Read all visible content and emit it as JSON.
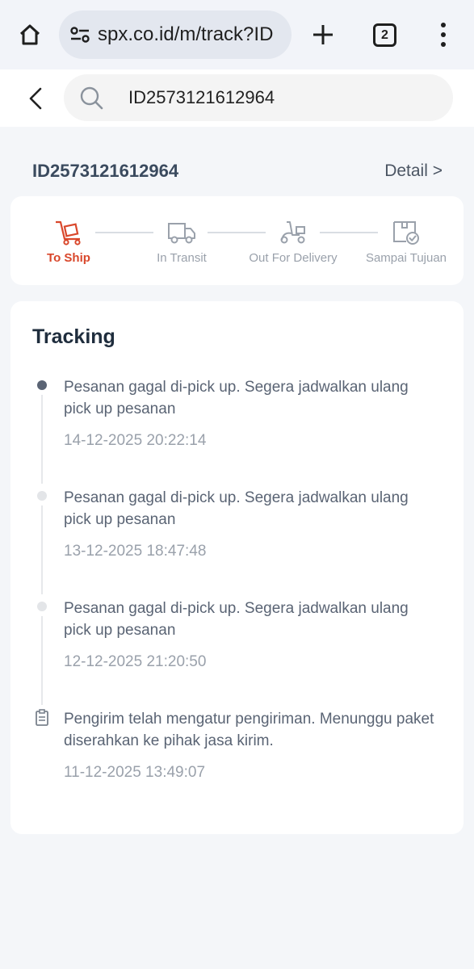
{
  "browser": {
    "url": "spx.co.id/m/track?ID",
    "tab_count": "2"
  },
  "search": {
    "value": "ID2573121612964"
  },
  "order": {
    "id": "ID2573121612964",
    "detail_label": "Detail >"
  },
  "status_steps": [
    {
      "label": "To Ship",
      "icon": "trolley-icon",
      "active": true
    },
    {
      "label": "In Transit",
      "icon": "truck-icon",
      "active": false
    },
    {
      "label": "Out For Delivery",
      "icon": "scooter-icon",
      "active": false
    },
    {
      "label": "Sampai Tujuan",
      "icon": "package-check-icon",
      "active": false
    }
  ],
  "tracking": {
    "title": "Tracking",
    "events": [
      {
        "text": "Pesanan gagal di-pick up. Segera jadwalkan ulang pick up pesanan",
        "time": "14-12-2025 20:22:14"
      },
      {
        "text": "Pesanan gagal di-pick up. Segera jadwalkan ulang pick up pesanan",
        "time": "13-12-2025 18:47:48"
      },
      {
        "text": "Pesanan gagal di-pick up. Segera jadwalkan ulang pick up pesanan",
        "time": "12-12-2025 21:20:50"
      },
      {
        "text": "Pengirim telah mengatur pengiriman. Menunggu paket diserahkan ke pihak jasa kirim.",
        "time": "11-12-2025 13:49:07"
      }
    ]
  },
  "colors": {
    "accent": "#d9472b",
    "page_bg": "#f4f6f9",
    "card_bg": "#ffffff"
  }
}
